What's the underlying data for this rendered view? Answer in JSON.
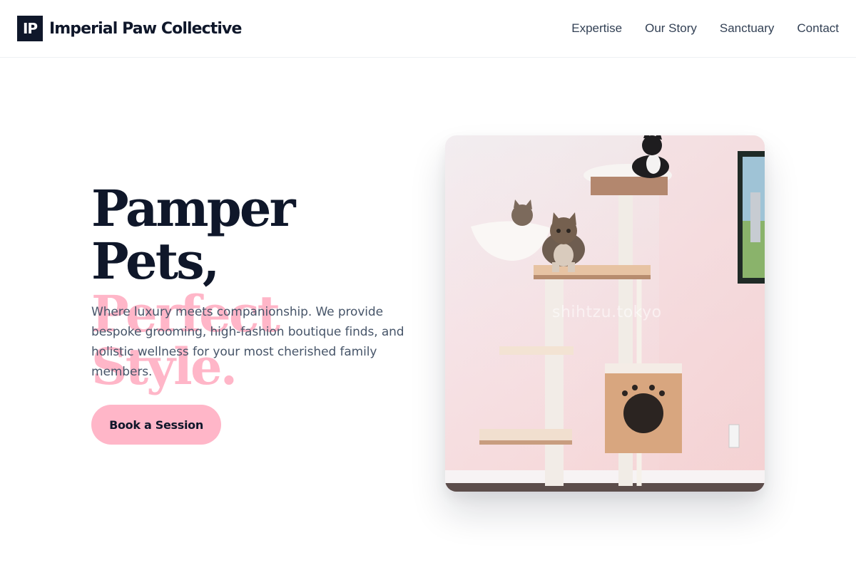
{
  "brand": {
    "mark": "IP",
    "name": "Imperial Paw Collective"
  },
  "nav": {
    "items": [
      {
        "label": "Expertise"
      },
      {
        "label": "Our Story"
      },
      {
        "label": "Sanctuary"
      },
      {
        "label": "Contact"
      }
    ]
  },
  "hero": {
    "headline_line1": "Pamper Pets,",
    "headline_line2": "Perfect Style.",
    "description": "Where luxury meets companionship. We provide bespoke grooming, high-fashion boutique finds, and holistic wellness for your most cherished family members.",
    "cta_label": "Book a Session",
    "image_watermark": "shihtzu.tokyo"
  },
  "colors": {
    "primary_dark": "#0f172a",
    "accent_pink": "#ffb6c8",
    "body_text": "#475569",
    "nav_text": "#334155"
  }
}
